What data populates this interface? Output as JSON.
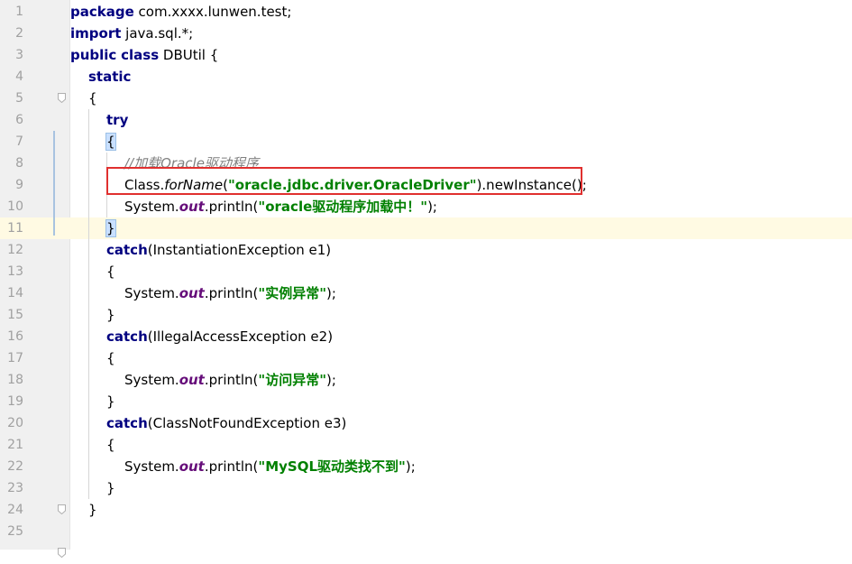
{
  "lines": [
    {
      "n": "1",
      "indent": 0,
      "tokens": [
        {
          "t": "package",
          "c": "kw"
        },
        {
          "t": " com.xxxx.lunwen.test;",
          "c": ""
        }
      ]
    },
    {
      "n": "2",
      "indent": 0,
      "tokens": [
        {
          "t": "import",
          "c": "kw"
        },
        {
          "t": " java.sql.*;",
          "c": ""
        }
      ]
    },
    {
      "n": "3",
      "indent": 0,
      "tokens": [
        {
          "t": "public",
          "c": "kw"
        },
        {
          "t": " ",
          "c": ""
        },
        {
          "t": "class",
          "c": "kw"
        },
        {
          "t": " DBUtil {",
          "c": ""
        }
      ]
    },
    {
      "n": "4",
      "indent": 1,
      "tokens": [
        {
          "t": "static",
          "c": "kw"
        }
      ]
    },
    {
      "n": "5",
      "indent": 1,
      "fold": true,
      "tokens": [
        {
          "t": "{",
          "c": ""
        }
      ]
    },
    {
      "n": "6",
      "indent": 2,
      "tokens": [
        {
          "t": "try",
          "c": "kw"
        }
      ]
    },
    {
      "n": "7",
      "indent": 2,
      "tokens": [
        {
          "t": "{",
          "c": "brace-hl"
        }
      ]
    },
    {
      "n": "8",
      "indent": 3,
      "tokens": [
        {
          "t": "//加载Oracle驱动程序",
          "c": "cmt"
        }
      ]
    },
    {
      "n": "9",
      "indent": 3,
      "tokens": [
        {
          "t": "Class.",
          "c": ""
        },
        {
          "t": "forName",
          "c": "itl"
        },
        {
          "t": "(",
          "c": ""
        },
        {
          "t": "\"oracle.jdbc.driver.OracleDriver\"",
          "c": "str"
        },
        {
          "t": ").newInstance();",
          "c": ""
        }
      ]
    },
    {
      "n": "10",
      "indent": 3,
      "tokens": [
        {
          "t": "System.",
          "c": ""
        },
        {
          "t": "out",
          "c": "fld"
        },
        {
          "t": ".println(",
          "c": ""
        },
        {
          "t": "\"oracle驱动程序加载中！\"",
          "c": "str"
        },
        {
          "t": ");",
          "c": ""
        }
      ]
    },
    {
      "n": "11",
      "indent": 2,
      "current": true,
      "tokens": [
        {
          "t": "}",
          "c": "brace-hl"
        }
      ]
    },
    {
      "n": "12",
      "indent": 2,
      "tokens": [
        {
          "t": "catch",
          "c": "kw"
        },
        {
          "t": "(InstantiationException e1)",
          "c": ""
        }
      ]
    },
    {
      "n": "13",
      "indent": 2,
      "tokens": [
        {
          "t": "{",
          "c": ""
        }
      ]
    },
    {
      "n": "14",
      "indent": 3,
      "tokens": [
        {
          "t": "System.",
          "c": ""
        },
        {
          "t": "out",
          "c": "fld"
        },
        {
          "t": ".println(",
          "c": ""
        },
        {
          "t": "\"实例异常\"",
          "c": "str"
        },
        {
          "t": ");",
          "c": ""
        }
      ]
    },
    {
      "n": "15",
      "indent": 2,
      "tokens": [
        {
          "t": "}",
          "c": ""
        }
      ]
    },
    {
      "n": "16",
      "indent": 2,
      "tokens": [
        {
          "t": "catch",
          "c": "kw"
        },
        {
          "t": "(IllegalAccessException e2)",
          "c": ""
        }
      ]
    },
    {
      "n": "17",
      "indent": 2,
      "tokens": [
        {
          "t": "{",
          "c": ""
        }
      ]
    },
    {
      "n": "18",
      "indent": 3,
      "tokens": [
        {
          "t": "System.",
          "c": ""
        },
        {
          "t": "out",
          "c": "fld"
        },
        {
          "t": ".println(",
          "c": ""
        },
        {
          "t": "\"访问异常\"",
          "c": "str"
        },
        {
          "t": ");",
          "c": ""
        }
      ]
    },
    {
      "n": "19",
      "indent": 2,
      "tokens": [
        {
          "t": "}",
          "c": ""
        }
      ]
    },
    {
      "n": "20",
      "indent": 2,
      "tokens": [
        {
          "t": "catch",
          "c": "kw"
        },
        {
          "t": "(ClassNotFoundException e3)",
          "c": ""
        }
      ]
    },
    {
      "n": "21",
      "indent": 2,
      "tokens": [
        {
          "t": "{",
          "c": ""
        }
      ]
    },
    {
      "n": "22",
      "indent": 3,
      "tokens": [
        {
          "t": "System.",
          "c": ""
        },
        {
          "t": "out",
          "c": "fld"
        },
        {
          "t": ".println(",
          "c": ""
        },
        {
          "t": "\"MySQL驱动类找不到\"",
          "c": "str"
        },
        {
          "t": ");",
          "c": ""
        }
      ]
    },
    {
      "n": "23",
      "indent": 2,
      "tokens": [
        {
          "t": "}",
          "c": ""
        }
      ]
    },
    {
      "n": "24",
      "indent": 1,
      "fold": true,
      "tokens": [
        {
          "t": "}",
          "c": ""
        }
      ]
    },
    {
      "n": "25",
      "indent": 0,
      "tokens": []
    },
    {
      "n": "",
      "indent": 0,
      "fold": true,
      "tokens": []
    }
  ],
  "colors": {
    "keyword": "#000080",
    "string": "#008000",
    "comment": "#808080",
    "field": "#660e7a",
    "highlight_box": "#e0302f",
    "current_line": "#fffae3"
  }
}
